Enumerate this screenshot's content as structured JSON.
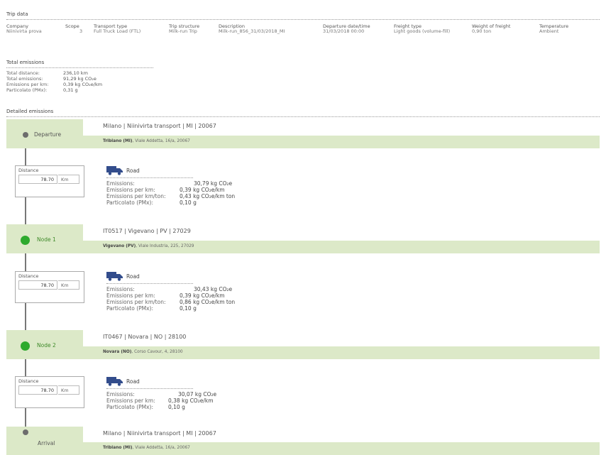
{
  "trip": {
    "section_title": "Trip data",
    "headers": [
      "Company",
      "Scope",
      "Transport type",
      "Trip structure",
      "Description",
      "Departure date/time",
      "Freight type",
      "Weight of freight",
      "Temperature"
    ],
    "values": [
      "Niinivirta prova",
      "3",
      "Full Truck Load (FTL)",
      "Milk-run Trip",
      "Milk-run_856_31/03/2018_MI",
      "31/03/2018 00:00",
      "Light goods (volume-fill)",
      "0,90 ton",
      "Ambient"
    ]
  },
  "totals": {
    "section_title": "Total emissions",
    "rows": [
      {
        "label": "Total distance:",
        "value": "236,10 km"
      },
      {
        "label": "Total emissions:",
        "value": "91,29 kg CO₂e"
      },
      {
        "label": "Emissions per km:",
        "value": "0,39 kg CO₂e/km"
      },
      {
        "label": "Particolato (PMx):",
        "value": "0,31 g"
      }
    ]
  },
  "detailed": {
    "section_title": "Detailed emissions"
  },
  "stops": [
    {
      "label": "Departure",
      "title": "Milano | Niinivirta transport | MI | 20067",
      "addr_bold": "Tribiano (MI)",
      "addr_rest": ", Viale Addetta, 16/a, 20067"
    },
    {
      "label": "Node 1",
      "title": "IT0517 | Vigevano | PV | 27029",
      "addr_bold": "Vigevano (PV)",
      "addr_rest": ", Viale Industria, 225, 27029"
    },
    {
      "label": "Node 2",
      "title": "IT0467 | Novara | NO | 28100",
      "addr_bold": "Novara (NO)",
      "addr_rest": ", Corso Cavour, 4, 28100"
    },
    {
      "label": "Arrival",
      "title": "Milano | Niinivirta transport | MI | 20067",
      "addr_bold": "Tribiano (MI)",
      "addr_rest": ", Viale Addetta, 16/a, 20067"
    }
  ],
  "legs": [
    {
      "distance_label": "Distance",
      "distance_value": "78.70",
      "distance_unit": "Km",
      "mode": "Road",
      "mode_icon": "truck-icon",
      "rows": [
        {
          "label": "Emissions:",
          "value": "30,79 kg CO₂e"
        },
        {
          "label": "Emissions per km:",
          "value": "0,39 kg CO₂e/km"
        },
        {
          "label": "Emissions per km/ton:",
          "value": "0,43 kg CO₂e/km ton"
        },
        {
          "label": "Particolato (PMx):",
          "value": "0,10 g"
        }
      ]
    },
    {
      "distance_label": "Distance",
      "distance_value": "78.70",
      "distance_unit": "Km",
      "mode": "Road",
      "mode_icon": "truck-icon",
      "rows": [
        {
          "label": "Emissions:",
          "value": "30,43 kg CO₂e"
        },
        {
          "label": "Emissions per km:",
          "value": "0,39 kg CO₂e/km"
        },
        {
          "label": "Emissions per km/ton:",
          "value": "0,86 kg CO₂e/km ton"
        },
        {
          "label": "Particolato (PMx):",
          "value": "0,10 g"
        }
      ]
    },
    {
      "distance_label": "Distance",
      "distance_value": "78.70",
      "distance_unit": "Km",
      "mode": "Road",
      "mode_icon": "truck-icon",
      "rows": [
        {
          "label": "Emissions:",
          "value": "30,07 kg CO₂e"
        },
        {
          "label": "Emissions per km:",
          "value": "0,38 kg CO₂e/km"
        },
        {
          "label": "Particolato (PMx):",
          "value": "0,10 g"
        }
      ]
    }
  ],
  "colors": {
    "node_green": "#2eaa2e",
    "band_green": "#dce9c8",
    "endpoint_grey": "#6d6d6d"
  }
}
